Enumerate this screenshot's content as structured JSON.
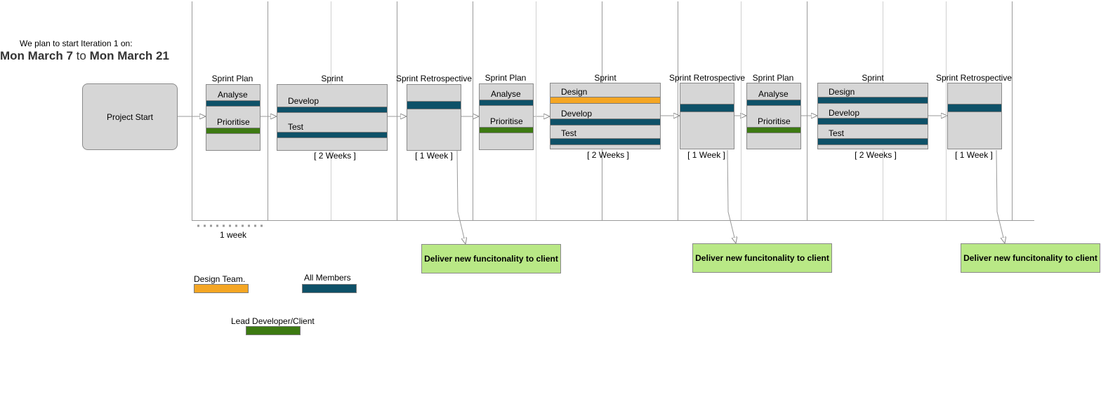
{
  "intro": {
    "line1": "We plan to start Iteration 1 on:",
    "date_start": "Mon March 7",
    "to": "to",
    "date_end": "Mon March 21"
  },
  "project_start": "Project Start",
  "phases": {
    "sprint_plan": "Sprint Plan",
    "sprint": "Sprint",
    "sprint_retro": "Sprint Retrospective"
  },
  "tasks": {
    "analyse": "Analyse",
    "prioritise": "Prioritise",
    "design": "Design",
    "develop": "Develop",
    "test": "Test"
  },
  "durations": {
    "two_weeks": "[ 2 Weeks ]",
    "one_week": "[ 1 Week ]"
  },
  "scale": {
    "label": "1 week"
  },
  "deliver": "Deliver new funcitonality to client",
  "legend": {
    "design_team": "Design Team.",
    "all_members": "All Members",
    "lead_dev_client": "Lead Developer/Client"
  },
  "colors": {
    "design_team": "#f5a623",
    "all_members": "#0e5168",
    "lead_dev_client": "#3d7a12",
    "deliver_box": "#b9e886",
    "box_fill": "#d6d6d6"
  }
}
